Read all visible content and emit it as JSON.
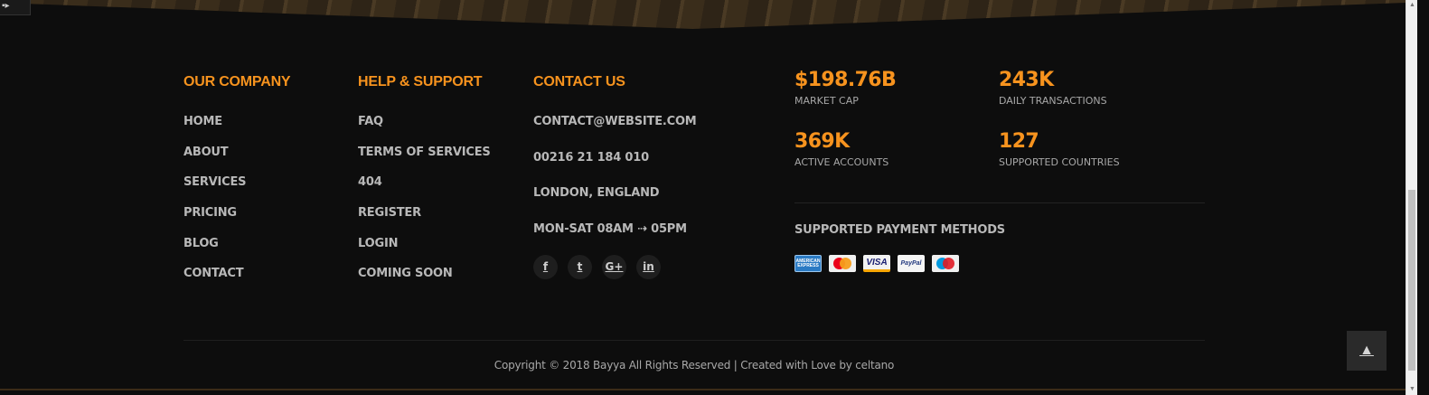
{
  "footer": {
    "company": {
      "title": "OUR COMPANY",
      "links": [
        "HOME",
        "ABOUT",
        "SERVICES",
        "PRICING",
        "BLOG",
        "CONTACT"
      ]
    },
    "support": {
      "title": "HELP & SUPPORT",
      "links": [
        "FAQ",
        "TERMS OF SERVICES",
        "404",
        "REGISTER",
        "LOGIN",
        "COMING SOON"
      ]
    },
    "contact": {
      "title": "CONTACT US",
      "email": "CONTACT@WEBSITE.COM",
      "phone": "00216 21 184 010",
      "location": "LONDON, ENGLAND",
      "hours": "MON-SAT 08AM ⇢ 05PM",
      "social": [
        {
          "icon": "facebook-icon",
          "glyph": "f"
        },
        {
          "icon": "twitter-icon",
          "glyph": "t"
        },
        {
          "icon": "google-plus-icon",
          "glyph": "G+"
        },
        {
          "icon": "linkedin-icon",
          "glyph": "in"
        }
      ]
    },
    "stats": [
      {
        "value": "$198.76B",
        "label": "MARKET CAP"
      },
      {
        "value": "243K",
        "label": "DAILY TRANSACTIONS"
      },
      {
        "value": "369K",
        "label": "ACTIVE ACCOUNTS"
      },
      {
        "value": "127",
        "label": "SUPPORTED COUNTRIES"
      }
    ],
    "payments": {
      "title": "SUPPORTED PAYMENT METHODS",
      "methods": [
        {
          "icon": "american-express-icon",
          "text": "AMERICAN EXPRESS"
        },
        {
          "icon": "mastercard-icon",
          "text": "MasterCard"
        },
        {
          "icon": "visa-icon",
          "text": "VISA"
        },
        {
          "icon": "paypal-icon",
          "text": "PayPal"
        },
        {
          "icon": "maestro-icon",
          "text": "Maestro"
        }
      ]
    },
    "copyright": "Copyright © 2018 Bayya All Rights Reserved | Created with Love by celtano"
  },
  "back_to_top": {
    "icon": "arrow-up-icon",
    "glyph": "🡅"
  },
  "colors": {
    "accent": "#f7931e",
    "background": "#0d0d0d",
    "text": "#b8b8b8"
  }
}
